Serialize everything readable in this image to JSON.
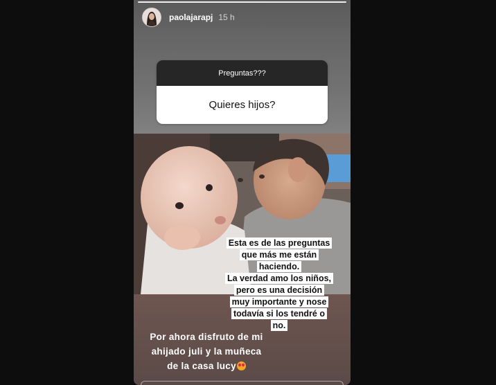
{
  "story": {
    "username": "paolajarapj",
    "timestamp": "15 h",
    "progress": 1.0
  },
  "question_sticker": {
    "title": "Preguntas???",
    "answer": "Quieres hijos?"
  },
  "captions": {
    "main_lines": [
      "Esta es de las preguntas",
      "que más me están",
      "haciendo.",
      "La verdad amo los niños,",
      "pero es una decisión",
      "muy importante y nose",
      "todavía si los tendré o",
      "no."
    ],
    "bottom_lines": [
      "Por ahora disfruto de mi",
      "ahijado juli y la muñeca",
      "de la casa lucy"
    ]
  },
  "icons": {
    "avatar": "profile-avatar",
    "emoji": "heart-eyes-emoji-icon"
  },
  "colors": {
    "background": "#0d0d0d",
    "sticker_header": "#262626",
    "sticker_body": "#ffffff"
  }
}
